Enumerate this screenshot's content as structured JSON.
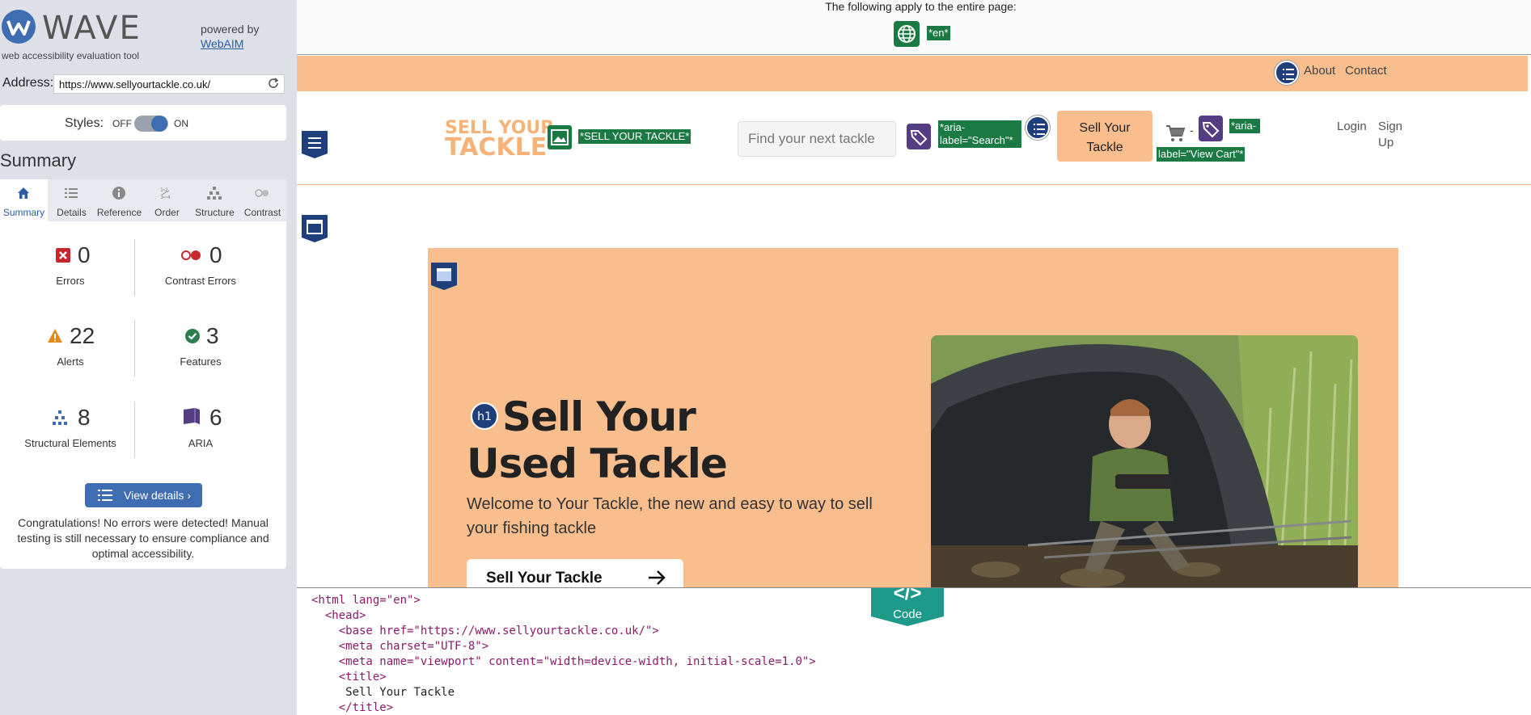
{
  "wave": {
    "title": "WAVE",
    "subtitle": "web accessibility evaluation tool",
    "powered_by": "powered by",
    "webaim_link": "WebAIM",
    "address_label": "Address:",
    "address_value": "https://www.sellyourtackle.co.uk/",
    "styles_label": "Styles:",
    "styles_off": "OFF",
    "styles_on": "ON",
    "styles_enabled": true,
    "summary_heading": "Summary",
    "tabs": [
      {
        "label": "Summary",
        "icon": "home-icon",
        "active": true
      },
      {
        "label": "Details",
        "icon": "list-icon",
        "active": false
      },
      {
        "label": "Reference",
        "icon": "info-icon",
        "active": false
      },
      {
        "label": "Order",
        "icon": "order-icon",
        "active": false
      },
      {
        "label": "Structure",
        "icon": "structure-icon",
        "active": false
      },
      {
        "label": "Contrast",
        "icon": "contrast-icon",
        "active": false
      }
    ],
    "stats": {
      "errors": {
        "value": "0",
        "label": "Errors"
      },
      "contrast_errors": {
        "value": "0",
        "label": "Contrast Errors"
      },
      "alerts": {
        "value": "22",
        "label": "Alerts"
      },
      "features": {
        "value": "3",
        "label": "Features"
      },
      "structural": {
        "value": "8",
        "label": "Structural Elements"
      },
      "aria": {
        "value": "6",
        "label": "ARIA"
      }
    },
    "view_details": "View details ›",
    "congrats": "Congratulations! No errors were detected! Manual testing is still necessary to ensure compliance and optimal accessibility."
  },
  "page": {
    "notice": "The following apply to the entire page:",
    "lang_tag": "*en*",
    "topbar_links": [
      "About",
      "Contact"
    ],
    "logo_line1": "SELL YOUR",
    "logo_line2": "TACKLE",
    "logo_alt_tag": "*SELL YOUR TACKLE*",
    "search_placeholder": "Find your next tackle",
    "search_aria_tag": "*aria-label=\"Search\"*",
    "sell_button_line1": "Sell Your",
    "sell_button_line2": "Tackle",
    "cart_separator": "-",
    "cart_aria_tag": "*aria-label=\"View Cart\"*",
    "login": "Login",
    "signup": "Sign Up",
    "hero_heading_badge": "h1",
    "hero_title": "Sell Your Used Tackle",
    "hero_text": "Welcome to Your Tackle, the new and easy to way to sell your fishing tackle",
    "hero_button": "Sell Your Tackle"
  },
  "code": {
    "toggle_glyph": "</>",
    "toggle_label": "Code",
    "lines": [
      "<html lang=\"en\">",
      "  <head>",
      "    <base href=\"https://www.sellyourtackle.co.uk/\">",
      "    <meta charset=\"UTF-8\">",
      "    <meta name=\"viewport\" content=\"width=device-width, initial-scale=1.0\">",
      "    <title>",
      "     Sell Your Tackle",
      "    </title>"
    ]
  },
  "colors": {
    "wave_blue": "#3e6db2",
    "brand_peach": "#f8be8e",
    "wave_green": "#1b7a43",
    "aria_purple": "#553d83",
    "code_teal": "#1d9a8a"
  }
}
